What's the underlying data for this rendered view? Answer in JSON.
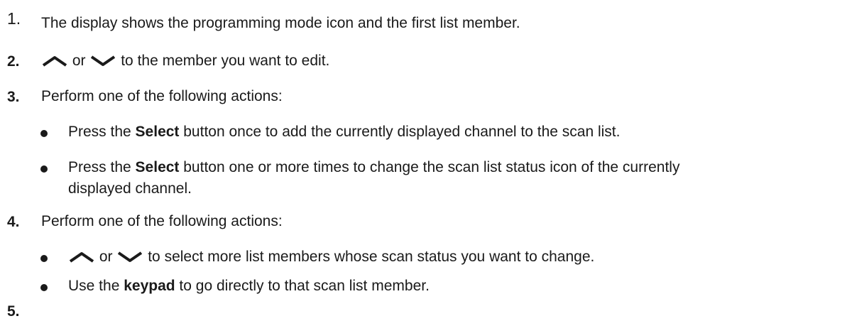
{
  "steps": [
    {
      "number": "1.",
      "text": "The display shows the programming mode icon and the first list member."
    },
    {
      "number": "2.",
      "or_word": "or",
      "text": "to the member you want to edit."
    },
    {
      "number": "3.",
      "text": "Perform one of the following actions:"
    },
    {
      "number": "4.",
      "text": "Perform one of the following actions:"
    },
    {
      "number": "5."
    }
  ],
  "step3_bullets": [
    {
      "pre": "Press the ",
      "bold": "Select",
      "post": " button once to add the currently displayed channel to the scan list."
    },
    {
      "pre": "Press the ",
      "bold": "Select",
      "post": " button one or more times to change the scan list status icon of the currently",
      "line2": "displayed channel."
    }
  ],
  "step4_bullets": [
    {
      "or_word": "or",
      "text": "to select more list members whose scan status you want to change."
    },
    {
      "pre": "Use the ",
      "bold": "keypad",
      "post": " to go directly to that scan list member."
    }
  ],
  "icons": {
    "up": "up-arrow-icon",
    "down": "down-arrow-icon"
  }
}
